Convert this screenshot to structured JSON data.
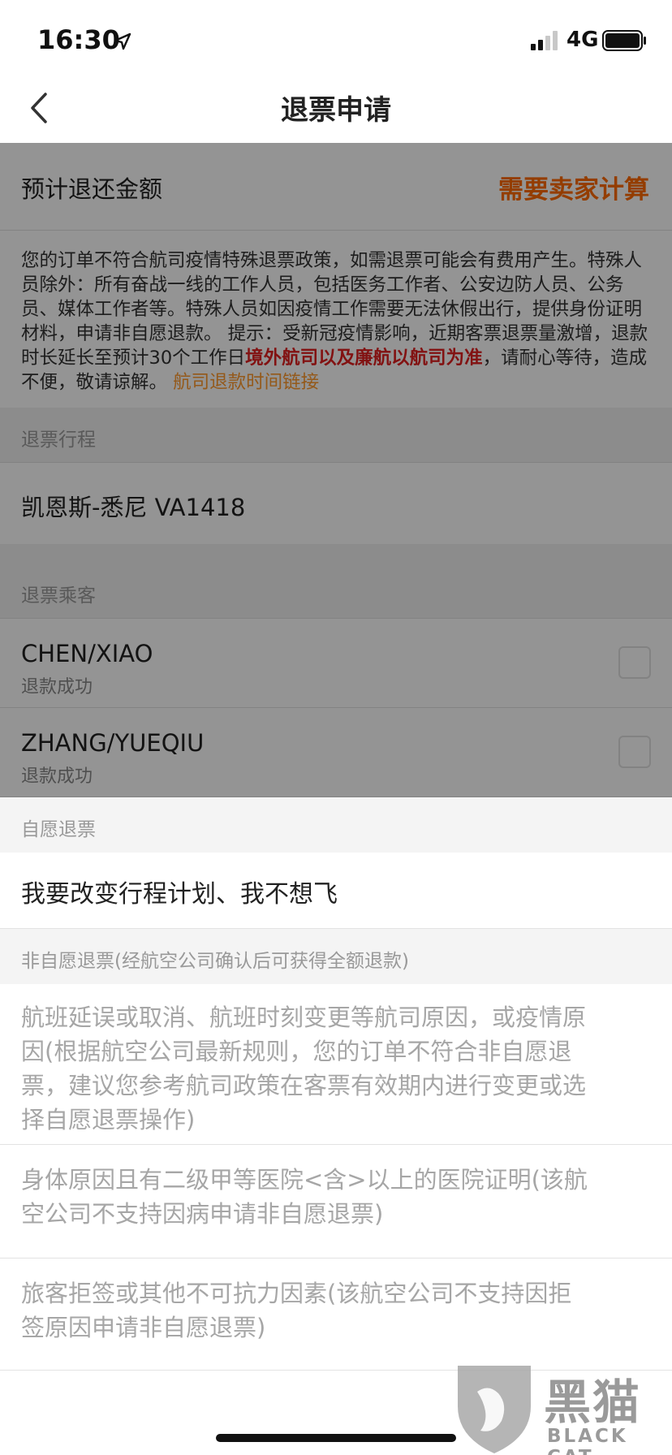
{
  "status_bar": {
    "time": "16:30",
    "network": "4G"
  },
  "nav": {
    "title": "退票申请"
  },
  "refund": {
    "label": "预计退还金额",
    "value": "需要卖家计算"
  },
  "notice": {
    "text": "您的订单不符合航司疫情特殊退票政策，如需退票可能会有费用产生。特殊人员除外：所有奋战一线的工作人员，包括医务工作者、公安边防人员、公务员、媒体工作者等。特殊人员如因疫情工作需要无法休假出行，提供身份证明材料，申请非自愿退款。 提示：受新冠疫情影响，近期客票退票量激增，退款时长延长至预计30个工作日",
    "highlight": "境外航司以及廉航以航司为准",
    "tail": "，请耐心等待，造成不便，敬请谅解。",
    "link": "航司退款时间链接"
  },
  "itinerary": {
    "header": "退票行程",
    "route": "凯恩斯-悉尼 VA1418"
  },
  "passengers": {
    "header": "退票乘客",
    "items": [
      {
        "name": "CHEN/XIAO",
        "status": "退款成功"
      },
      {
        "name": "ZHANG/YUEQIU",
        "status": "退款成功"
      }
    ]
  },
  "sheet": {
    "voluntary_header": "自愿退票",
    "voluntary_option": "我要改变行程计划、我不想飞",
    "involuntary_header": "非自愿退票(经航空公司确认后可获得全额退款)",
    "involuntary_options": [
      "航班延误或取消、航班时刻变更等航司原因，或疫情原因(根据航空公司最新规则，您的订单不符合非自愿退票，建议您参考航司政策在客票有效期内进行变更或选择自愿退票操作)",
      "身体原因且有二级甲等医院<含>以上的医院证明(该航空公司不支持因病申请非自愿退票)",
      "旅客拒签或其他不可抗力因素(该航空公司不支持因拒签原因申请非自愿退票)"
    ]
  },
  "watermark": {
    "cn": "黑猫",
    "en": "BLACK CAT"
  },
  "colors": {
    "accent": "#ff6a00",
    "warning": "#e02020",
    "link": "#ff9a2e"
  },
  "icons": [
    "location-arrow-icon",
    "signal-icon",
    "battery-icon",
    "back-arrow-icon",
    "checkbox-icon",
    "black-cat-logo"
  ]
}
